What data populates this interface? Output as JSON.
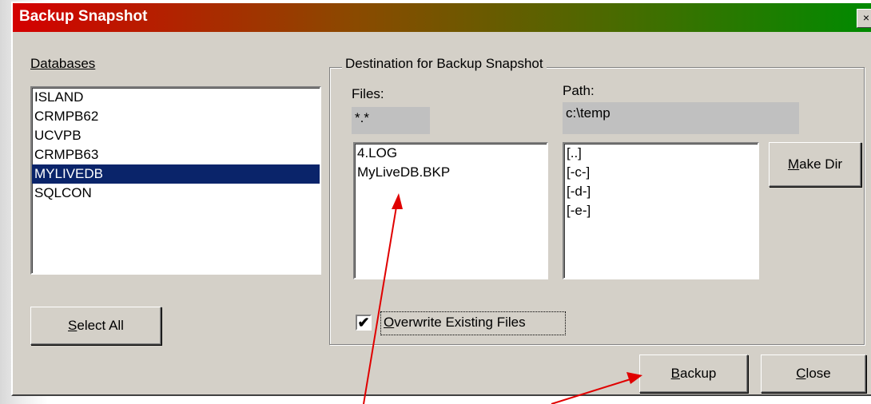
{
  "window": {
    "title": "Backup Snapshot",
    "close_glyph": "×"
  },
  "colors": {
    "titlebar_start": "#d40000",
    "titlebar_end": "#008a00",
    "selection": "#0a246a",
    "annotation_arrow": "#e00000"
  },
  "databases": {
    "label": "Databases",
    "items": [
      "ISLAND",
      "CRMPB62",
      "UCVPB",
      "CRMPB63",
      "MYLIVEDB",
      "SQLCON"
    ],
    "selected": "MYLIVEDB",
    "select_all_label": "Select All",
    "select_all_mnemonic": "S",
    "select_all_rest": "elect All"
  },
  "destination": {
    "legend": "Destination for Backup Snapshot",
    "files_label": "Files:",
    "files_filter": "*.*",
    "files": [
      "4.LOG",
      "MyLiveDB.BKP"
    ],
    "path_label": "Path:",
    "path_value": "c:\\temp",
    "dirs": [
      "[..]",
      "[-c-]",
      "[-d-]",
      "[-e-]"
    ],
    "make_dir_mnemonic": "M",
    "make_dir_rest": "ake Dir",
    "overwrite_checked": true,
    "overwrite_mnemonic": "O",
    "overwrite_rest": "verwrite Existing Files",
    "check_glyph": "✔"
  },
  "actions": {
    "backup_mnemonic": "B",
    "backup_rest": "ackup",
    "close_mnemonic": "C",
    "close_rest": "lose"
  },
  "annotations": {
    "arrow_count": 2
  }
}
